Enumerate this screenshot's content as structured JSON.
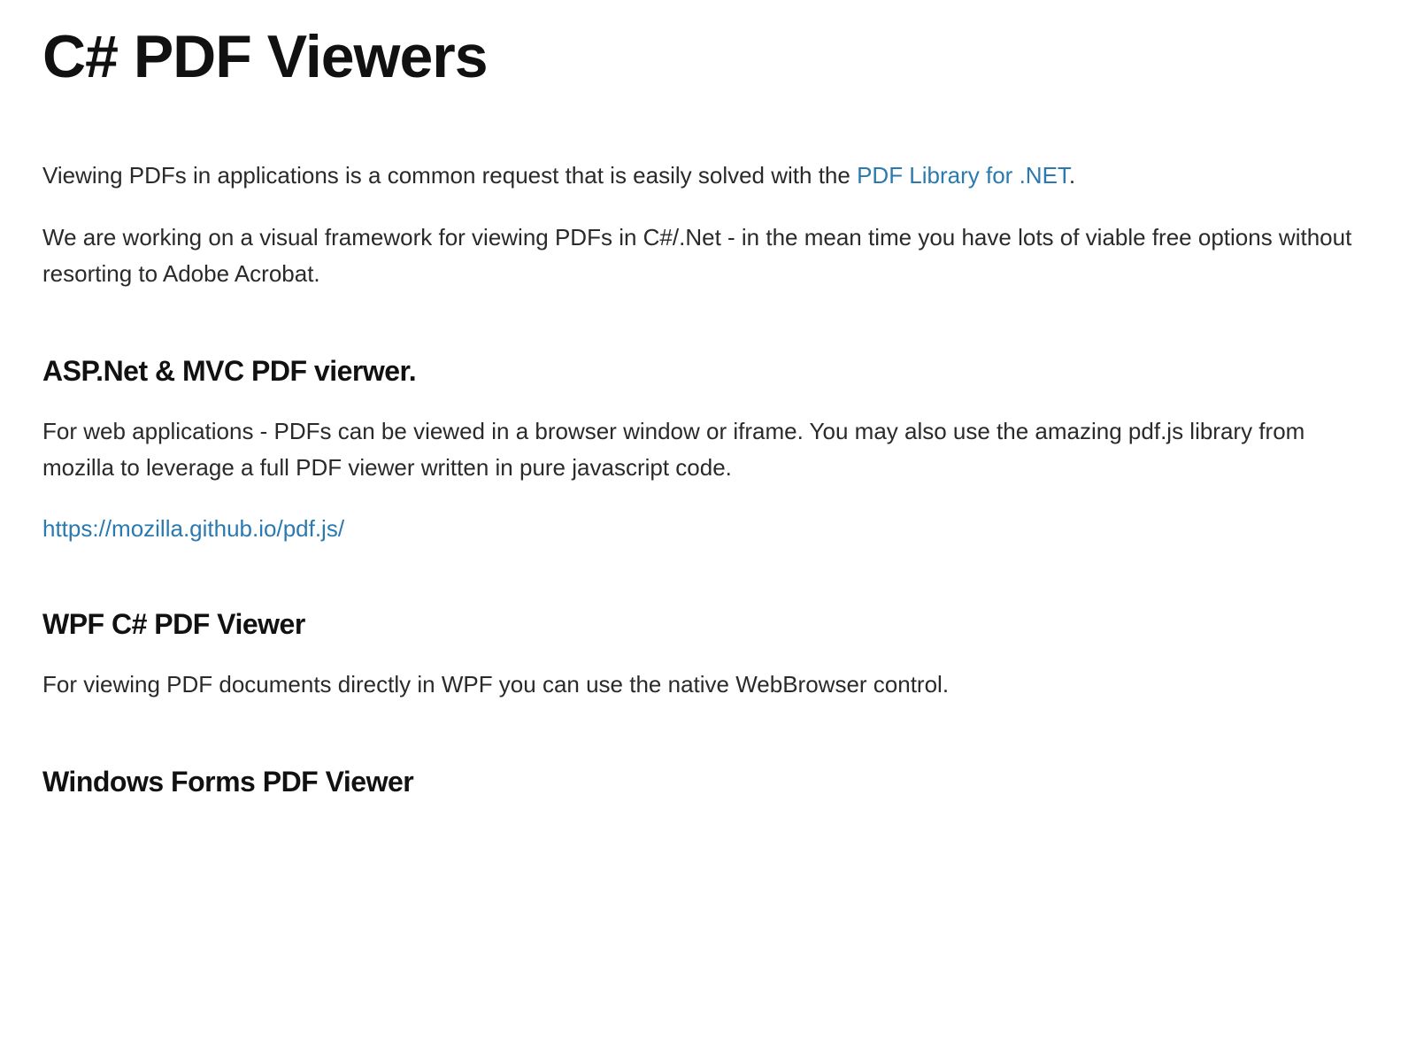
{
  "title": "C# PDF Viewers",
  "intro": {
    "p1_before_link": "Viewing PDFs in applications is a common request that is easily solved with the ",
    "p1_link_text": "PDF Library for .NET",
    "p1_after_link": ".",
    "p2": "We are working on a visual framework for viewing PDFs in C#/.Net - in the mean time you have lots of viable free options without resorting to Adobe Acrobat."
  },
  "sections": {
    "asp": {
      "heading": "ASP.Net & MVC PDF vierwer.",
      "p1": "For web applications - PDFs can be viewed in a browser window or iframe. You may also use the amazing pdf.js library from mozilla to leverage a full PDF viewer written in pure javascript code.",
      "link_text": "https://mozilla.github.io/pdf.js/"
    },
    "wpf": {
      "heading": "WPF C# PDF Viewer",
      "p1": "For viewing PDF documents directly in WPF you can use the native WebBrowser control."
    },
    "winforms": {
      "heading": "Windows Forms PDF Viewer"
    }
  }
}
